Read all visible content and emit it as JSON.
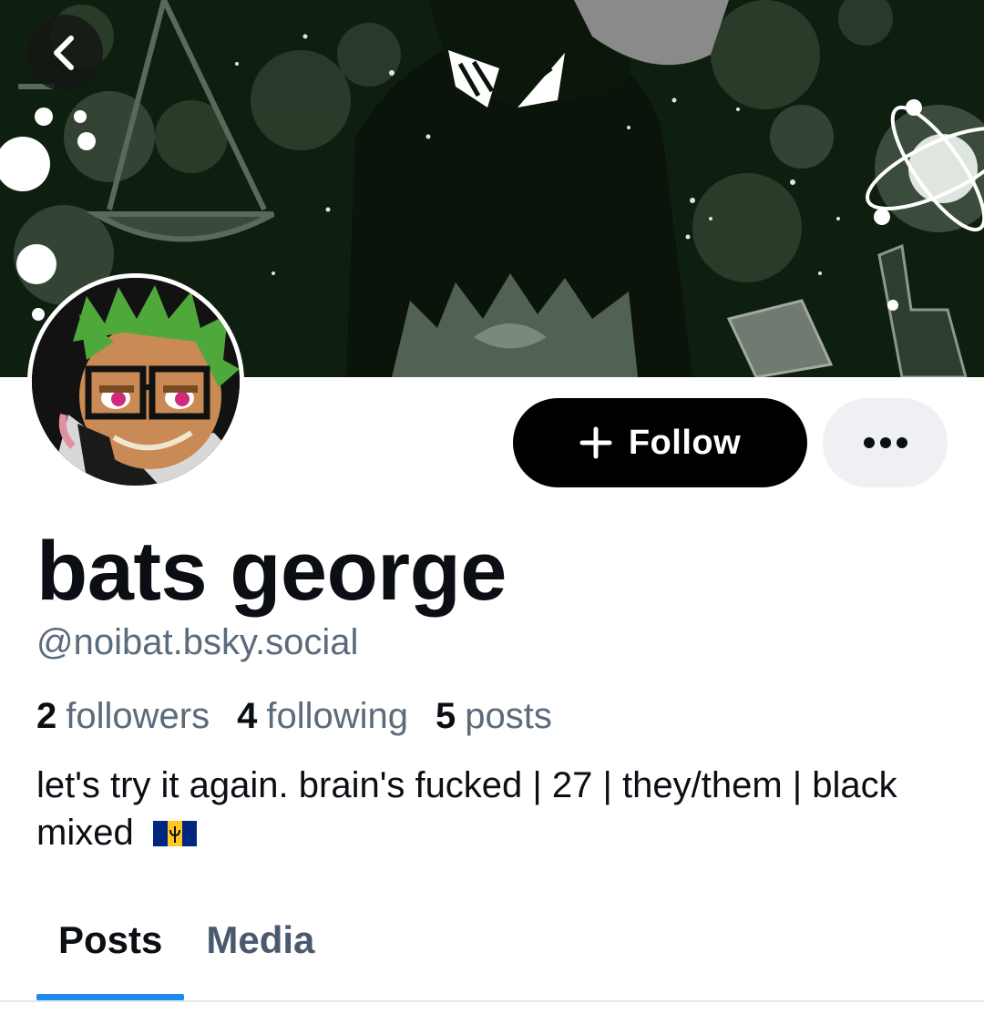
{
  "profile": {
    "display_name": "bats george",
    "handle": "@noibat.bsky.social",
    "stats": [
      {
        "count": "2",
        "label": "followers"
      },
      {
        "count": "4",
        "label": "following"
      },
      {
        "count": "5",
        "label": "posts"
      }
    ],
    "bio": "let's try it again. brain's fucked | 27 | they/them | black mixed"
  },
  "actions": {
    "follow_label": "Follow",
    "back_icon": "chevron-left-icon",
    "more_icon": "ellipsis-icon",
    "plus_icon": "plus-icon"
  },
  "tabs": [
    {
      "label": "Posts",
      "active": true
    },
    {
      "label": "Media",
      "active": false
    }
  ],
  "colors": {
    "accent": "#1d8cf0",
    "follow_bg": "#000000",
    "secondary_text": "#5b6b7b",
    "banner_bg": "#0f1f0f"
  }
}
